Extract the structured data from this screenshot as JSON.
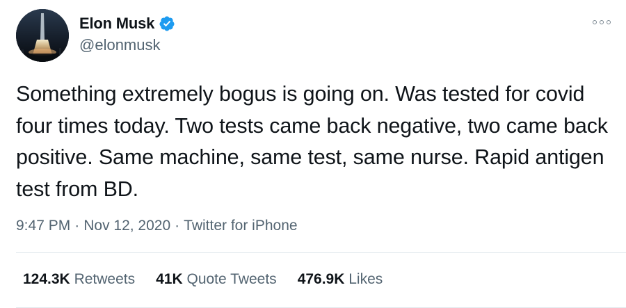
{
  "author": {
    "display_name": "Elon Musk",
    "handle": "@elonmusk",
    "verified": true,
    "avatar_icon": "rocket-launch-avatar"
  },
  "tweet": {
    "text": "Something extremely bogus is going on. Was tested for covid four times today. Two tests came back negative, two came back positive. Same machine, same test, same nurse. Rapid antigen test from BD.",
    "time": "9:47 PM",
    "date": "Nov 12, 2020",
    "source": "Twitter for iPhone",
    "separator": "·"
  },
  "stats": [
    {
      "count": "124.3K",
      "label": "Retweets"
    },
    {
      "count": "41K",
      "label": "Quote Tweets"
    },
    {
      "count": "476.9K",
      "label": "Likes"
    }
  ],
  "colors": {
    "text_primary": "#0f1419",
    "text_secondary": "#536471",
    "verified_blue": "#1d9bf0",
    "divider": "#e1e8ed"
  },
  "icons": {
    "verified": "verified-badge-icon",
    "more": "more-options-icon"
  }
}
